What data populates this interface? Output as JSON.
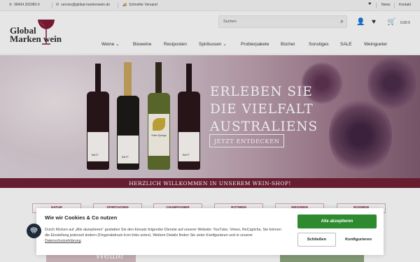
{
  "topbar": {
    "phone": "08434 202083-0",
    "email": "service@global-markenwein.de",
    "shipping": "Schneller Versand",
    "news": "News",
    "contact": "Kontakt",
    "icons": [
      "phone-icon",
      "mail-icon",
      "truck-icon",
      "heart-icon"
    ]
  },
  "header": {
    "logo_line1": "Global",
    "logo_line2": "Marken wein",
    "search_placeholder": "Suchen",
    "cart_total": "0,00 €",
    "icons": [
      "search-icon",
      "user-icon",
      "heart-icon",
      "cart-icon"
    ]
  },
  "nav": {
    "items": [
      "Weine",
      "Bioweine",
      "Restposten",
      "Spirituosen",
      "Probierpakete",
      "Bücher",
      "Sonstiges",
      "SALE",
      "Weingueter"
    ]
  },
  "hero": {
    "title_line1": "ERLEBEN SIE",
    "title_line2": "DIE VIELFALT",
    "title_line3": "AUSTRALIENS",
    "cta": "JETZT ENTDECKEN",
    "welcome": "HERZLICH WILLKOMMEN IN UNSEREM WEIN-SHOP!",
    "bottle_labels": [
      "BATT",
      "BATT",
      "Eden Springs",
      "BATT"
    ]
  },
  "categories": [
    "NATUR",
    "SPIRITUOSEN",
    "CHAMPAGNER",
    "ROTWEIN",
    "WEISWEIN",
    "ROSWEIN"
  ],
  "promo_text": "Weine",
  "cookie": {
    "title": "Wie wir Cookies & Co nutzen",
    "text": "Durch Klicken auf „Alle akzeptieren“ gestatten Sie den Einsatz folgender Dienste auf unserer Website: YouTube, Vimeo, ReCaptcha. Sie können die Einstellung jederzeit ändern (Fingerabdruck-Icon links unten). Weitere Details finden Sie unter",
    "text_configure": "Konfigurieren",
    "text_and": "und in unserer",
    "text_privacy": "Datenschutzerklärung",
    "accept_all": "Alle akzeptieren",
    "close": "Schließen",
    "configure": "Konfigurieren"
  },
  "colors": {
    "brand": "#6e1f33",
    "accept": "#2e8a2f"
  }
}
